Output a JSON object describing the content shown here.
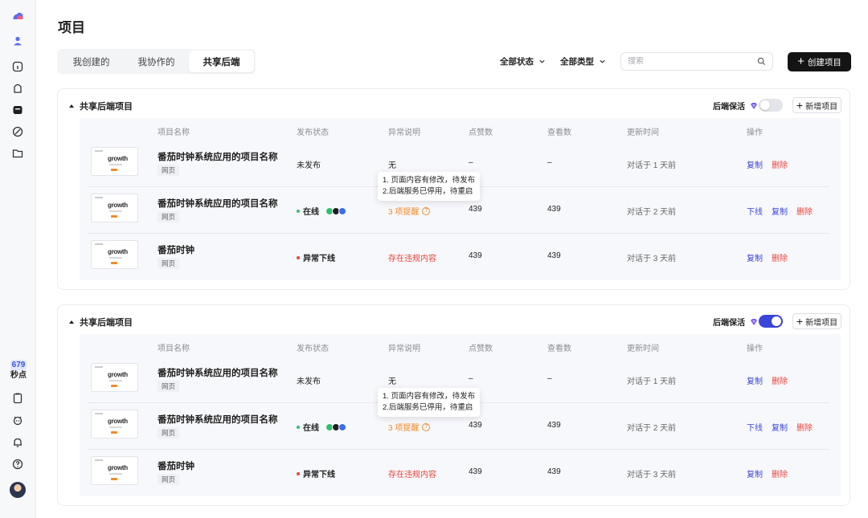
{
  "page": {
    "title": "项目"
  },
  "sidebar": {
    "count_num": "679",
    "count_label": "秒点"
  },
  "tabs": [
    {
      "label": "我创建的",
      "active": false
    },
    {
      "label": "我协作的",
      "active": false
    },
    {
      "label": "共享后端",
      "active": true
    }
  ],
  "filters": {
    "status": "全部状态",
    "type": "全部类型"
  },
  "search": {
    "placeholder": "搜索"
  },
  "create_button": {
    "label": "创建项目"
  },
  "table_headers": [
    "项目名称",
    "发布状态",
    "异常说明",
    "点赞数",
    "查看数",
    "更新时间",
    "操作"
  ],
  "panels": [
    {
      "title": "共享后端项目",
      "keepalive_label": "后端保活",
      "keepalive_on": false,
      "add_label": "新增项目",
      "tooltip": [
        "1. 页面内容有修改，待发布",
        "2.后端服务已停用，待重启"
      ],
      "rows": [
        {
          "name": "番茄时钟系统应用的项目名称",
          "tag": "网页",
          "thumb_text": "growth",
          "status": "未发布",
          "note": "无",
          "likes": "–",
          "views": "–",
          "updated": "对话于 1 天前",
          "ops": [
            "复制",
            "删除"
          ]
        },
        {
          "name": "番茄时钟系统应用的项目名称",
          "tag": "网页",
          "thumb_text": "growth",
          "status": "在线",
          "note": "3 项提醒",
          "likes": "439",
          "views": "439",
          "updated": "对话于 2 天前",
          "ops": [
            "下线",
            "复制",
            "删除"
          ]
        },
        {
          "name": "番茄时钟",
          "tag": "网页",
          "thumb_text": "growth",
          "status": "异常下线",
          "note": "存在违规内容",
          "likes": "439",
          "views": "439",
          "updated": "对话于 3 天前",
          "ops": [
            "复制",
            "删除"
          ]
        }
      ]
    },
    {
      "title": "共享后端项目",
      "keepalive_label": "后端保活",
      "keepalive_on": true,
      "add_label": "新增项目",
      "tooltip": [
        "1. 页面内容有修改，待发布",
        "2.后端服务已停用，待重启"
      ],
      "rows": [
        {
          "name": "番茄时钟系统应用的项目名称",
          "tag": "网页",
          "thumb_text": "growth",
          "status": "未发布",
          "note": "无",
          "likes": "–",
          "views": "–",
          "updated": "对话于 1 天前",
          "ops": [
            "复制",
            "删除"
          ]
        },
        {
          "name": "番茄时钟系统应用的项目名称",
          "tag": "网页",
          "thumb_text": "growth",
          "status": "在线",
          "note": "3 项提醒",
          "likes": "439",
          "views": "439",
          "updated": "对话于 2 天前",
          "ops": [
            "下线",
            "复制",
            "删除"
          ]
        },
        {
          "name": "番茄时钟",
          "tag": "网页",
          "thumb_text": "growth",
          "status": "异常下线",
          "note": "存在违规内容",
          "likes": "439",
          "views": "439",
          "updated": "对话于 3 天前",
          "ops": [
            "复制",
            "删除"
          ]
        }
      ]
    }
  ],
  "colors": {
    "accent": "#3b45d9",
    "online": "#2fbf71",
    "error": "#e8453c",
    "warn": "#f08a2b",
    "badges": [
      "#2fbf71",
      "#1f1f1f",
      "#3b6cf6"
    ]
  },
  "icons": [
    "logo-icon",
    "user-icon",
    "home-icon",
    "plugin-icon",
    "store-icon",
    "compass-icon",
    "folder-icon",
    "clipboard-icon",
    "bot-icon",
    "bell-icon",
    "help-icon"
  ]
}
